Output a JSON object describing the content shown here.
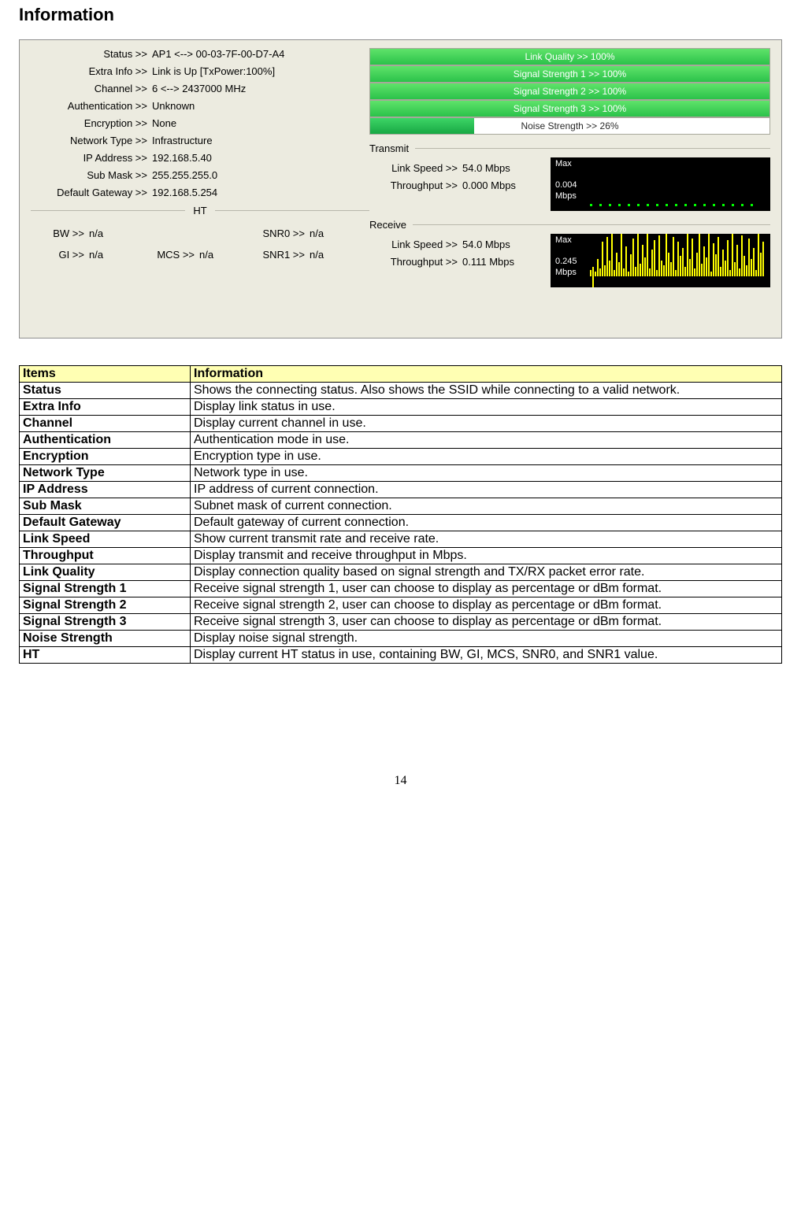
{
  "title": "Information",
  "page_number": "14",
  "panel": {
    "fields": [
      {
        "label": "Status >>",
        "value": "AP1 <--> 00-03-7F-00-D7-A4"
      },
      {
        "label": "Extra Info >>",
        "value": "Link is Up [TxPower:100%]"
      },
      {
        "label": "Channel >>",
        "value": "6 <--> 2437000 MHz"
      },
      {
        "label": "Authentication >>",
        "value": "Unknown"
      },
      {
        "label": "Encryption >>",
        "value": "None"
      },
      {
        "label": "Network Type >>",
        "value": "Infrastructure"
      },
      {
        "label": "IP Address >>",
        "value": "192.168.5.40"
      },
      {
        "label": "Sub Mask >>",
        "value": "255.255.255.0"
      },
      {
        "label": "Default Gateway >>",
        "value": "192.168.5.254"
      }
    ],
    "ht_label": "HT",
    "ht": [
      {
        "label": "BW >>",
        "value": "n/a"
      },
      {
        "label": "SNR0 >>",
        "value": "n/a"
      },
      {
        "label": "GI >>",
        "value": "n/a"
      },
      {
        "label": "MCS >>",
        "value": "n/a"
      },
      {
        "label": "SNR1 >>",
        "value": "n/a"
      }
    ],
    "bars": [
      {
        "text": "Link Quality >> 100%",
        "fill": 100,
        "dark": false
      },
      {
        "text": "Signal Strength 1 >> 100%",
        "fill": 100,
        "dark": false
      },
      {
        "text": "Signal Strength 2 >> 100%",
        "fill": 100,
        "dark": false
      },
      {
        "text": "Signal Strength 3 >> 100%",
        "fill": 100,
        "dark": false
      },
      {
        "text": "Noise Strength >> 26%",
        "fill": 26,
        "dark": true
      }
    ],
    "transmit_label": "Transmit",
    "transmit": {
      "linkspeed_label": "Link Speed >>",
      "linkspeed_value": "54.0 Mbps",
      "throughput_label": "Throughput >>",
      "throughput_value": "0.000 Mbps",
      "graph_title": "Max",
      "graph_value": "0.004\nMbps"
    },
    "receive_label": "Receive",
    "receive": {
      "linkspeed_label": "Link Speed >>",
      "linkspeed_value": "54.0 Mbps",
      "throughput_label": "Throughput >>",
      "throughput_value": "0.111 Mbps",
      "graph_title": "Max",
      "graph_value": "0.245\nMbps"
    }
  },
  "table": {
    "head": {
      "items": "Items",
      "info": "Information"
    },
    "rows": [
      {
        "item": "Status",
        "info": "Shows the connecting status. Also shows the SSID while connecting to a valid network."
      },
      {
        "item": "Extra Info",
        "info": "Display link status in use."
      },
      {
        "item": "Channel",
        "info": "Display current channel in use."
      },
      {
        "item": "Authentication",
        "info": "Authentication mode in use."
      },
      {
        "item": "Encryption",
        "info": "Encryption type in use."
      },
      {
        "item": "Network Type",
        "info": "Network type in use."
      },
      {
        "item": "IP Address",
        "info": "IP address of current connection."
      },
      {
        "item": "Sub Mask",
        "info": "Subnet mask of current connection."
      },
      {
        "item": "Default Gateway",
        "info": "Default gateway of current connection."
      },
      {
        "item": "Link Speed",
        "info": "Show current transmit rate and receive rate."
      },
      {
        "item": "Throughput",
        "info": "Display transmit and receive throughput in Mbps."
      },
      {
        "item": "Link Quality",
        "info": "Display connection quality based on signal strength and TX/RX packet error rate."
      },
      {
        "item": "Signal Strength 1",
        "info": "Receive signal strength 1, user can choose to display as percentage or dBm format."
      },
      {
        "item": "Signal Strength 2",
        "info": "Receive signal strength 2, user can choose to display as percentage or dBm format."
      },
      {
        "item": "Signal Strength 3",
        "info": "Receive signal strength 3, user can choose to display as percentage or dBm format."
      },
      {
        "item": "Noise Strength",
        "info": "Display noise signal strength."
      },
      {
        "item": "HT",
        "info": "Display current HT status in use, containing BW, GI, MCS, SNR0, and SNR1 value."
      }
    ]
  }
}
